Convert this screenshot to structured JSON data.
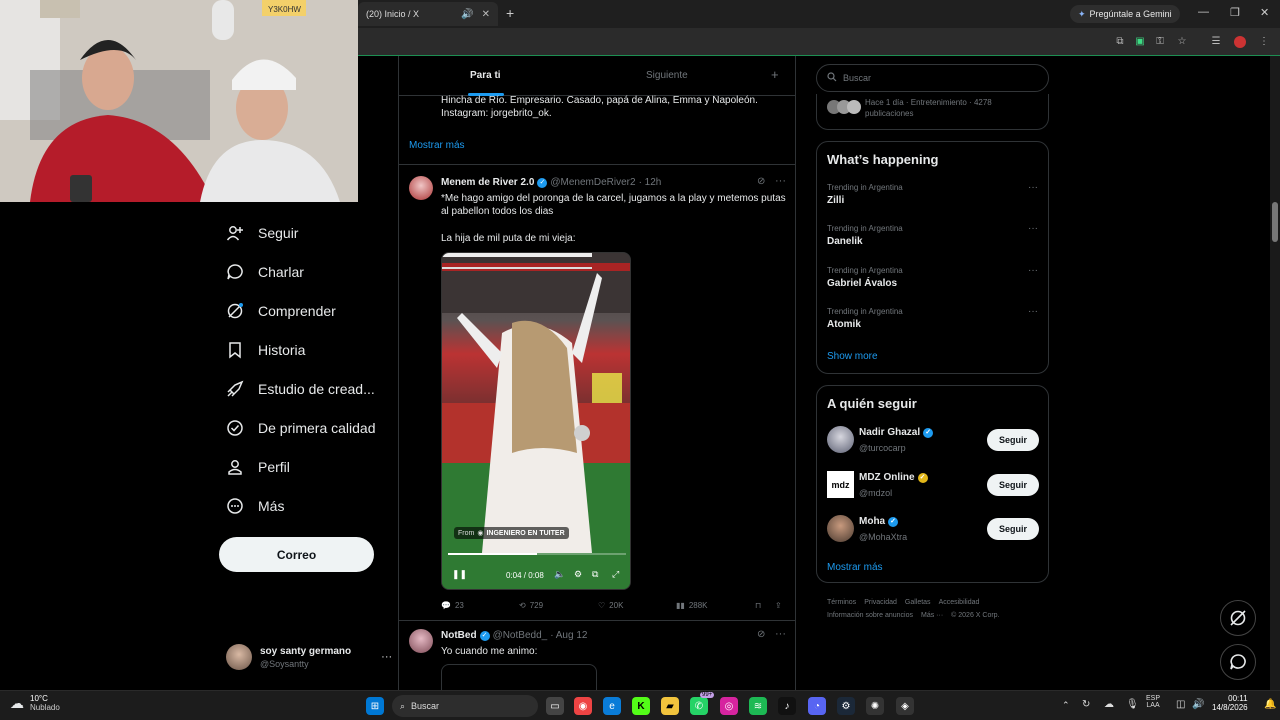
{
  "browser": {
    "tab_title": "(20) Inicio / X",
    "gemini_label": "Pregúntale a Gemini"
  },
  "nav": {
    "items": [
      {
        "label": "Seguir",
        "icon": "person-add-icon"
      },
      {
        "label": "Charlar",
        "icon": "chat-icon"
      },
      {
        "label": "Comprender",
        "icon": "grok-icon"
      },
      {
        "label": "Historia",
        "icon": "bookmark-icon"
      },
      {
        "label": "Estudio de cread...",
        "icon": "rocket-icon"
      },
      {
        "label": "De primera calidad",
        "icon": "verified-badge-icon"
      },
      {
        "label": "Perfil",
        "icon": "person-icon"
      },
      {
        "label": "Más",
        "icon": "more-circle-icon"
      }
    ],
    "cta_label": "Correo",
    "account": {
      "name": "soy santy germano",
      "handle": "@Soysantty"
    }
  },
  "feed": {
    "tabs": [
      "Para ti",
      "Siguiente"
    ],
    "bio_line1": "Hincha de Río. Empresario. Casado, papá de Alina, Emma y Napoleón.",
    "bio_line2": "Instagram: jorgebrito_ok.",
    "show_more": "Mostrar más",
    "tweet1": {
      "name": "Menem de River 2.0",
      "handle": "@MenemDeRiver2",
      "time": "· 12h",
      "text1": "*Me hago amigo del poronga de la carcel, jugamos a la play y metemos putas al pabellon todos los dias",
      "text2": "La hija de mil puta de mi vieja:",
      "video_from": "From",
      "video_source": "INGENIERO EN TUITER",
      "video_time": "0:04 / 0:08",
      "video_progress": 0.5,
      "replies": "23",
      "retweets": "729",
      "likes": "20K",
      "views": "288K"
    },
    "tweet2": {
      "name": "NotBed",
      "handle": "@NotBedd_",
      "time": "· Aug 12",
      "text": "Yo cuando me animo:"
    }
  },
  "right": {
    "search_placeholder": "Buscar",
    "community_meta": "Hace 1 día · Entretenimiento · 4278",
    "community_meta2": "publicaciones",
    "happening_title": "What’s happening",
    "trends": [
      {
        "category": "Trending in Argentina",
        "name": "Zilli"
      },
      {
        "category": "Trending in Argentina",
        "name": "Danelik"
      },
      {
        "category": "Trending in Argentina",
        "name": "Gabriel Ávalos"
      },
      {
        "category": "Trending in Argentina",
        "name": "Atomik"
      }
    ],
    "show_more": "Show more",
    "who_title": "A quién seguir",
    "who": [
      {
        "name": "Nadir Ghazal",
        "handle": "@turcocarp",
        "button": "Seguir"
      },
      {
        "name": "MDZ Online",
        "handle": "@mdzol",
        "button": "Seguir",
        "logo_text": "mdz"
      },
      {
        "name": "Moha",
        "handle": "@MohaXtra",
        "button": "Seguir"
      }
    ],
    "who_more": "Mostrar más",
    "footer": [
      "Términos",
      "Privacidad",
      "Galletas",
      "Accesibilidad",
      "Información sobre anuncios",
      "Más ···",
      "© 2026 X Corp."
    ]
  },
  "taskbar": {
    "weather_temp": "10°C",
    "weather_desc": "Nublado",
    "search_label": "Buscar",
    "whatsapp_badge": "99+",
    "lang1": "ESP",
    "lang2": "LAA",
    "time": "00:11",
    "date": "14/8/2026"
  },
  "webcam": {
    "sign_text": "Y3K0HW"
  }
}
